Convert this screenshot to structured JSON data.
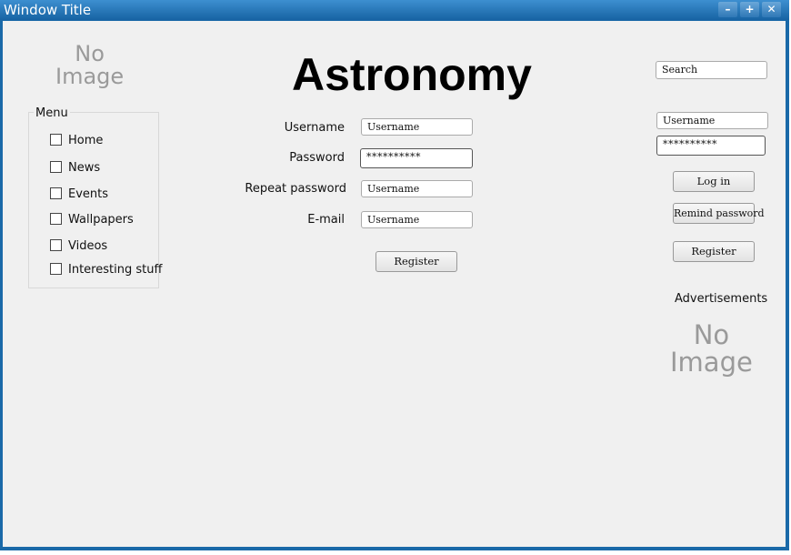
{
  "window": {
    "title": "Window Title",
    "minimize_glyph": "–",
    "maximize_glyph": "+",
    "close_glyph": "✕"
  },
  "logo": {
    "line1": "No",
    "line2": "Image"
  },
  "page_title": "Astronomy",
  "menu": {
    "legend": "Menu",
    "items": [
      "Home",
      "News",
      "Events",
      "Wallpapers",
      "Videos",
      "Interesting stuff"
    ]
  },
  "register_form": {
    "username_label": "Username",
    "username_value": "Username",
    "password_label": "Password",
    "password_value": "**********",
    "repeat_label": "Repeat password",
    "repeat_value": "Username",
    "email_label": "E-mail",
    "email_value": "Username",
    "register_button": "Register"
  },
  "sidebar": {
    "search_value": "Search",
    "login_username": "Username",
    "login_password": "**********",
    "login_button": "Log in",
    "remind_button": "Remind password",
    "register_button": "Register",
    "ads_label": "Advertisements",
    "ad_line1": "No",
    "ad_line2": "Image"
  }
}
